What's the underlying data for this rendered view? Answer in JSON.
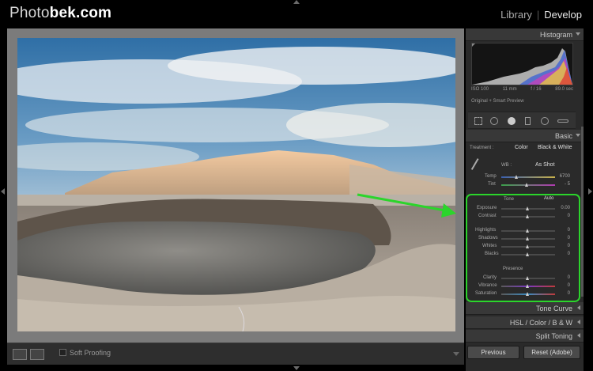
{
  "brand": {
    "prefix": "Photo",
    "bold": "bek.com"
  },
  "modules": {
    "library": "Library",
    "sep": "|",
    "develop": "Develop"
  },
  "toolbar": {
    "soft_proofing": "Soft Proofing"
  },
  "panel": {
    "histogram": {
      "title": "Histogram",
      "exif": {
        "iso": "ISO 100",
        "focal": "11 mm",
        "aperture": "f / 16",
        "shutter": "89.0 sec"
      },
      "original": "Original + Smart Preview"
    },
    "basic": {
      "title": "Basic",
      "treatment_label": "Treatment :",
      "treatment_color": "Color",
      "treatment_bw": "Black & White",
      "wb_label": "WB :",
      "wb_value": "As Shot",
      "temp": {
        "label": "Temp",
        "value": "6700",
        "pos": 0.3
      },
      "tint": {
        "label": "Tint",
        "value": "- 5",
        "pos": 0.47
      },
      "tone_label": "Tone",
      "auto_label": "Auto",
      "exposure": {
        "label": "Exposure",
        "value": "0.00",
        "pos": 0.5
      },
      "contrast": {
        "label": "Contrast",
        "value": "0",
        "pos": 0.5
      },
      "highlights": {
        "label": "Highlights",
        "value": "0",
        "pos": 0.5
      },
      "shadows": {
        "label": "Shadows",
        "value": "0",
        "pos": 0.5
      },
      "whites": {
        "label": "Whites",
        "value": "0",
        "pos": 0.5
      },
      "blacks": {
        "label": "Blacks",
        "value": "0",
        "pos": 0.5
      },
      "presence_label": "Presence",
      "clarity": {
        "label": "Clarity",
        "value": "0",
        "pos": 0.5
      },
      "vibrance": {
        "label": "Vibrance",
        "value": "0",
        "pos": 0.5
      },
      "saturation": {
        "label": "Saturation",
        "value": "0",
        "pos": 0.5
      }
    },
    "tone_curve": "Tone Curve",
    "hsl": "HSL  /  Color  /  B & W",
    "split_toning": "Split Toning",
    "previous": "Previous",
    "reset": "Reset (Adobe)"
  },
  "colors": {
    "highlight_box": "#2bd52b",
    "panel_bg": "#2a2a2a"
  }
}
